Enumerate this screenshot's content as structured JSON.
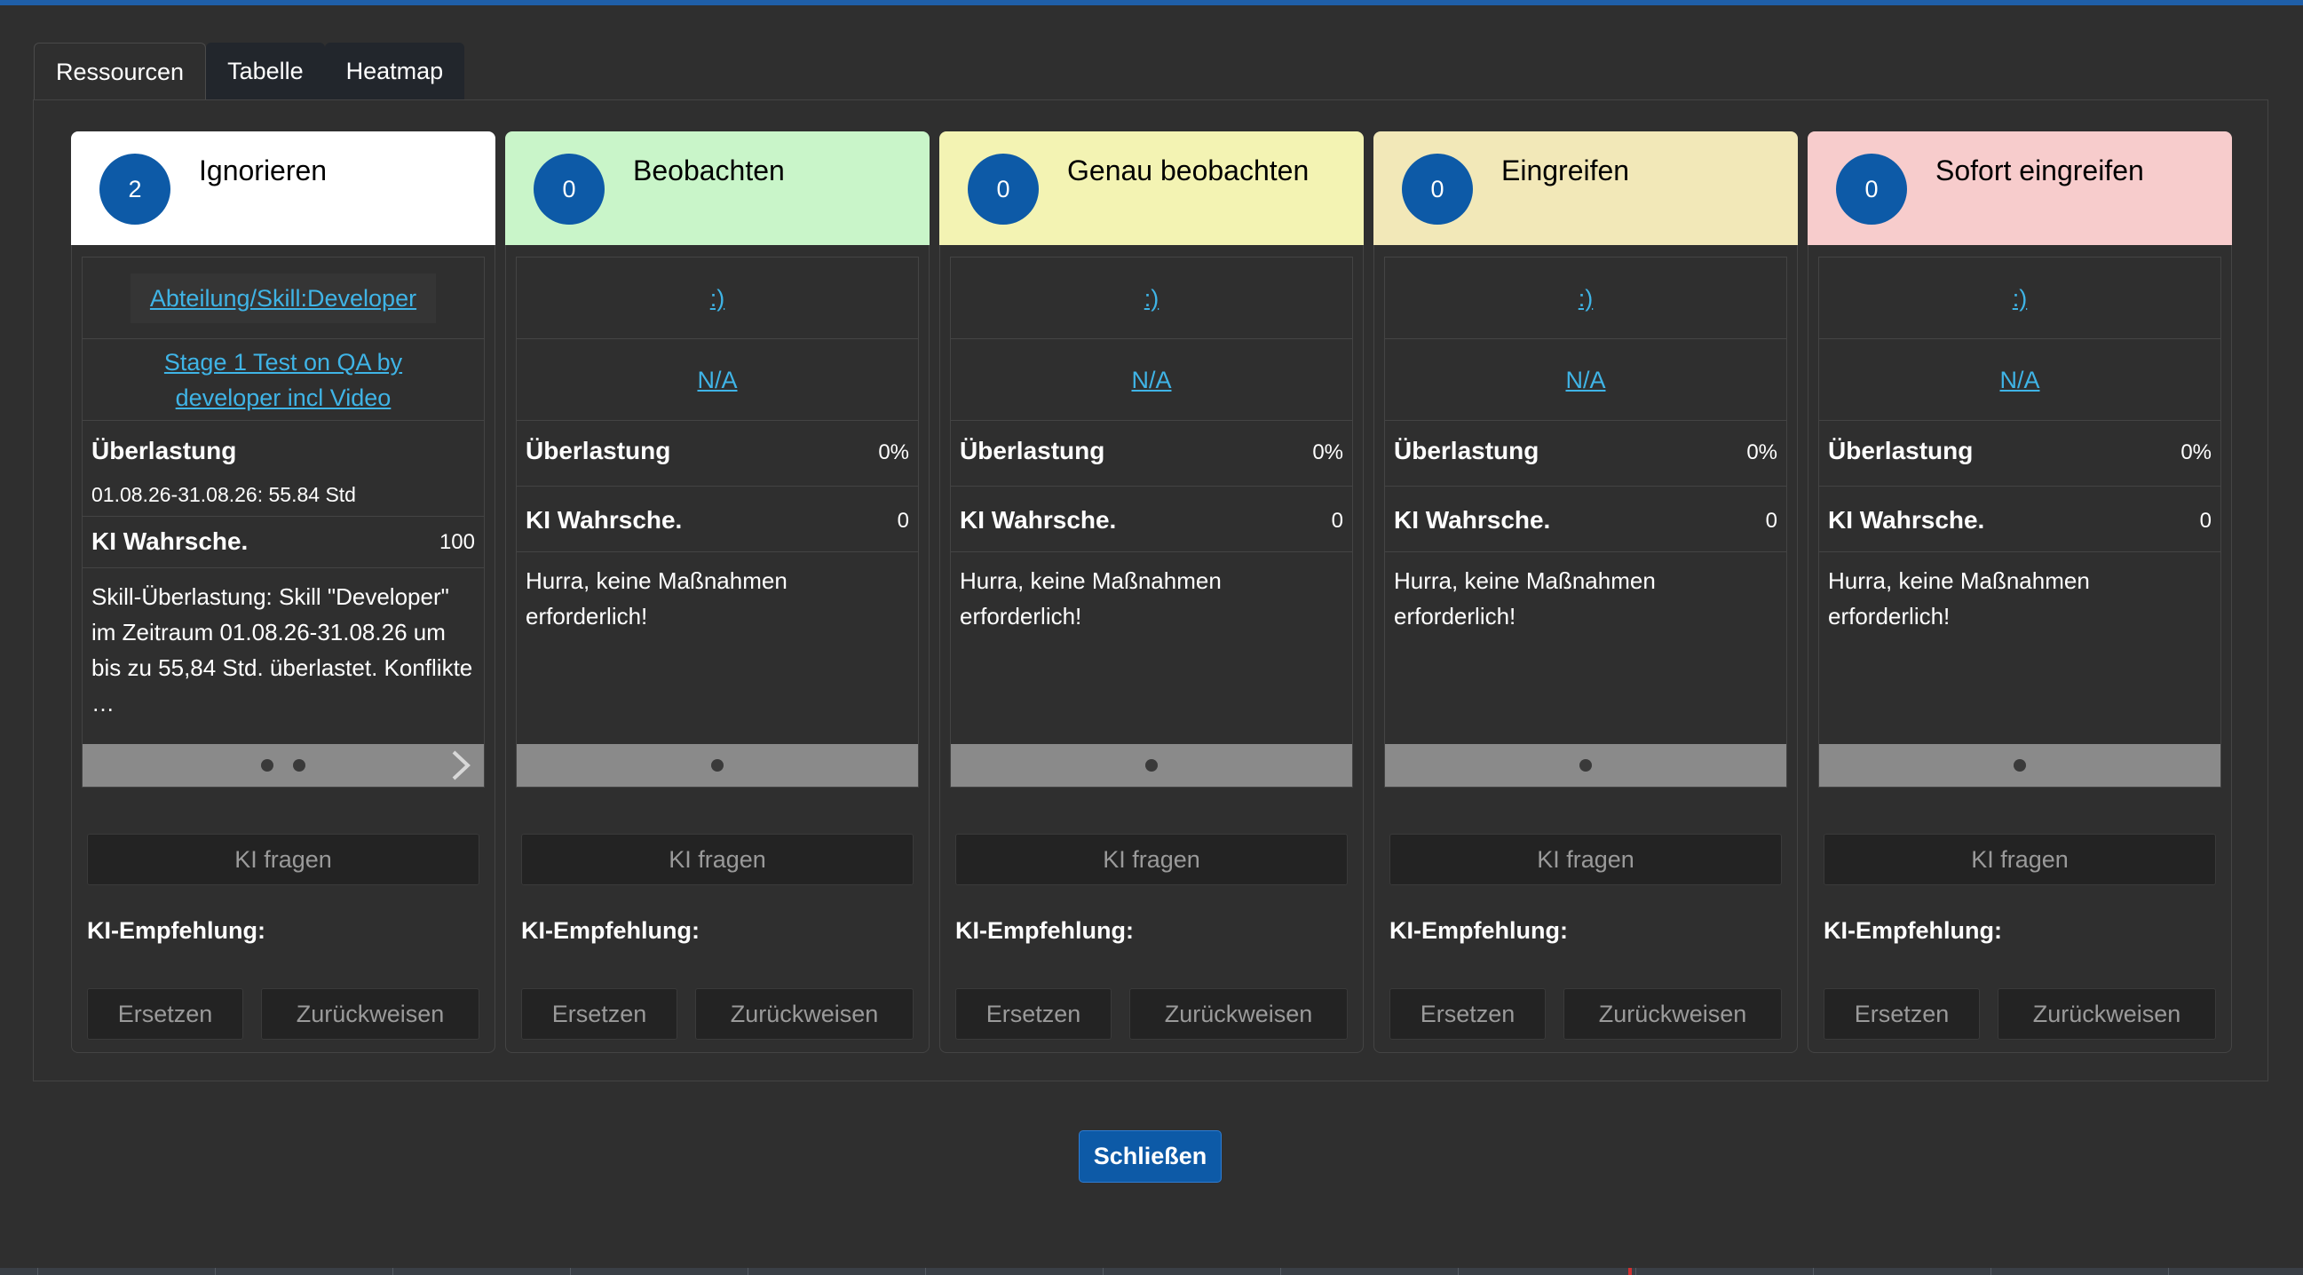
{
  "tabs": [
    "Ressourcen",
    "Tabelle",
    "Heatmap"
  ],
  "colors": {
    "accent": "#0d5aa7",
    "link": "#3fb4e6",
    "ignorieren": "#ffffff",
    "beobachten": "#c9f5c9",
    "genau_beobachten": "#f3f3b3",
    "eingreifen": "#f2e8b8",
    "sofort_eingreifen": "#f7cccc"
  },
  "columns": [
    {
      "count": "2",
      "title": "Ignorieren",
      "link1": " Abteilung/Skill:Developer ",
      "link2": "Stage 1 Test on QA by developer incl Video",
      "overload_label": "Überlastung",
      "overload_value": "",
      "overload_detail": "01.08.26-31.08.26: 55.84 Std",
      "ki_label": "KI Wahrsche.",
      "ki_value": "100",
      "message": " Skill-Überlastung: Skill \"Developer\" im Zeitraum 01.08.26-31.08.26 um bis zu 55,84 Std. überlastet. Konflikte …",
      "slides": 2,
      "ask_label": "KI fragen",
      "empf_label": "KI-Empfehlung:",
      "replace_label": "Ersetzen",
      "reject_label": "Zurückweisen"
    },
    {
      "count": "0",
      "title": "Beobachten",
      "link1": " :) ",
      "link2": "N/A",
      "overload_label": "Überlastung",
      "overload_value": "0%",
      "ki_label": "KI Wahrsche.",
      "ki_value": "0",
      "message": " Hurra, keine Maßnahmen erforderlich!",
      "slides": 1,
      "ask_label": "KI fragen",
      "empf_label": "KI-Empfehlung:",
      "replace_label": "Ersetzen",
      "reject_label": "Zurückweisen"
    },
    {
      "count": "0",
      "title": "Genau beobachten",
      "link1": " :) ",
      "link2": "N/A",
      "overload_label": "Überlastung",
      "overload_value": "0%",
      "ki_label": "KI Wahrsche.",
      "ki_value": "0",
      "message": " Hurra, keine Maßnahmen erforderlich!",
      "slides": 1,
      "ask_label": "KI fragen",
      "empf_label": "KI-Empfehlung:",
      "replace_label": "Ersetzen",
      "reject_label": "Zurückweisen"
    },
    {
      "count": "0",
      "title": "Eingreifen",
      "link1": " :) ",
      "link2": "N/A",
      "overload_label": "Überlastung",
      "overload_value": "0%",
      "ki_label": "KI Wahrsche.",
      "ki_value": "0",
      "message": " Hurra, keine Maßnahmen erforderlich!",
      "slides": 1,
      "ask_label": "KI fragen",
      "empf_label": "KI-Empfehlung:",
      "replace_label": "Ersetzen",
      "reject_label": "Zurückweisen"
    },
    {
      "count": "0",
      "title": "Sofort eingreifen",
      "link1": " :) ",
      "link2": "N/A",
      "overload_label": "Überlastung",
      "overload_value": "0%",
      "ki_label": "KI Wahrsche.",
      "ki_value": "0",
      "message": " Hurra, keine Maßnahmen erforderlich!",
      "slides": 1,
      "ask_label": "KI fragen",
      "empf_label": "KI-Empfehlung:",
      "replace_label": "Ersetzen",
      "reject_label": "Zurückweisen"
    }
  ],
  "close_label": "Schließen"
}
